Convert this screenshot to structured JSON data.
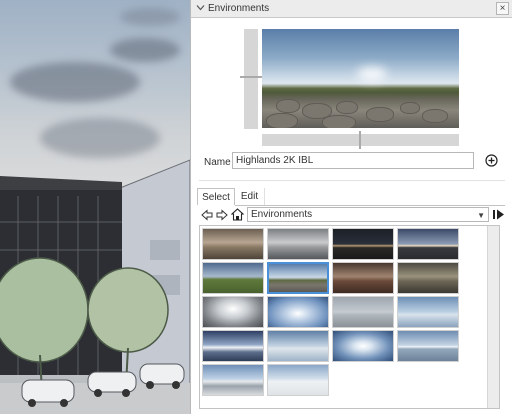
{
  "panel": {
    "title": "Environments",
    "close_glyph": "×"
  },
  "preview": {
    "name_label": "Name",
    "name_value": "Highlands 2K IBL"
  },
  "tabs": [
    {
      "label": "Select",
      "active": true
    },
    {
      "label": "Edit",
      "active": false
    }
  ],
  "collection": {
    "selected": "Environments"
  },
  "thumbnails": [
    {
      "name": "thumb-1",
      "style": "interior-warm",
      "selected": false
    },
    {
      "name": "thumb-2",
      "style": "interior-grey",
      "selected": false
    },
    {
      "name": "thumb-3",
      "style": "night-horizon",
      "selected": false
    },
    {
      "name": "thumb-4",
      "style": "dusk-sky",
      "selected": false
    },
    {
      "name": "thumb-5",
      "style": "green-field",
      "selected": false
    },
    {
      "name": "thumb-6",
      "style": "highlands",
      "selected": true
    },
    {
      "name": "thumb-7",
      "style": "ruins-red",
      "selected": false
    },
    {
      "name": "thumb-8",
      "style": "warehouse",
      "selected": false
    },
    {
      "name": "thumb-9",
      "style": "fisheye",
      "selected": false
    },
    {
      "name": "thumb-10",
      "style": "blue-sky",
      "selected": false
    },
    {
      "name": "thumb-11",
      "style": "overcast",
      "selected": false
    },
    {
      "name": "thumb-12",
      "style": "pale-sky",
      "selected": false
    },
    {
      "name": "thumb-13",
      "style": "sunset-clouds",
      "selected": false
    },
    {
      "name": "thumb-14",
      "style": "soft-sky",
      "selected": false
    },
    {
      "name": "thumb-15",
      "style": "bright-sun",
      "selected": false
    },
    {
      "name": "thumb-16",
      "style": "sea-horizon",
      "selected": false
    },
    {
      "name": "thumb-17",
      "style": "dome",
      "selected": false
    },
    {
      "name": "thumb-18",
      "style": "snow-field",
      "selected": false
    }
  ],
  "colors": {
    "accent": "#4a90d9",
    "panel_bg": "#f3f3f3"
  }
}
